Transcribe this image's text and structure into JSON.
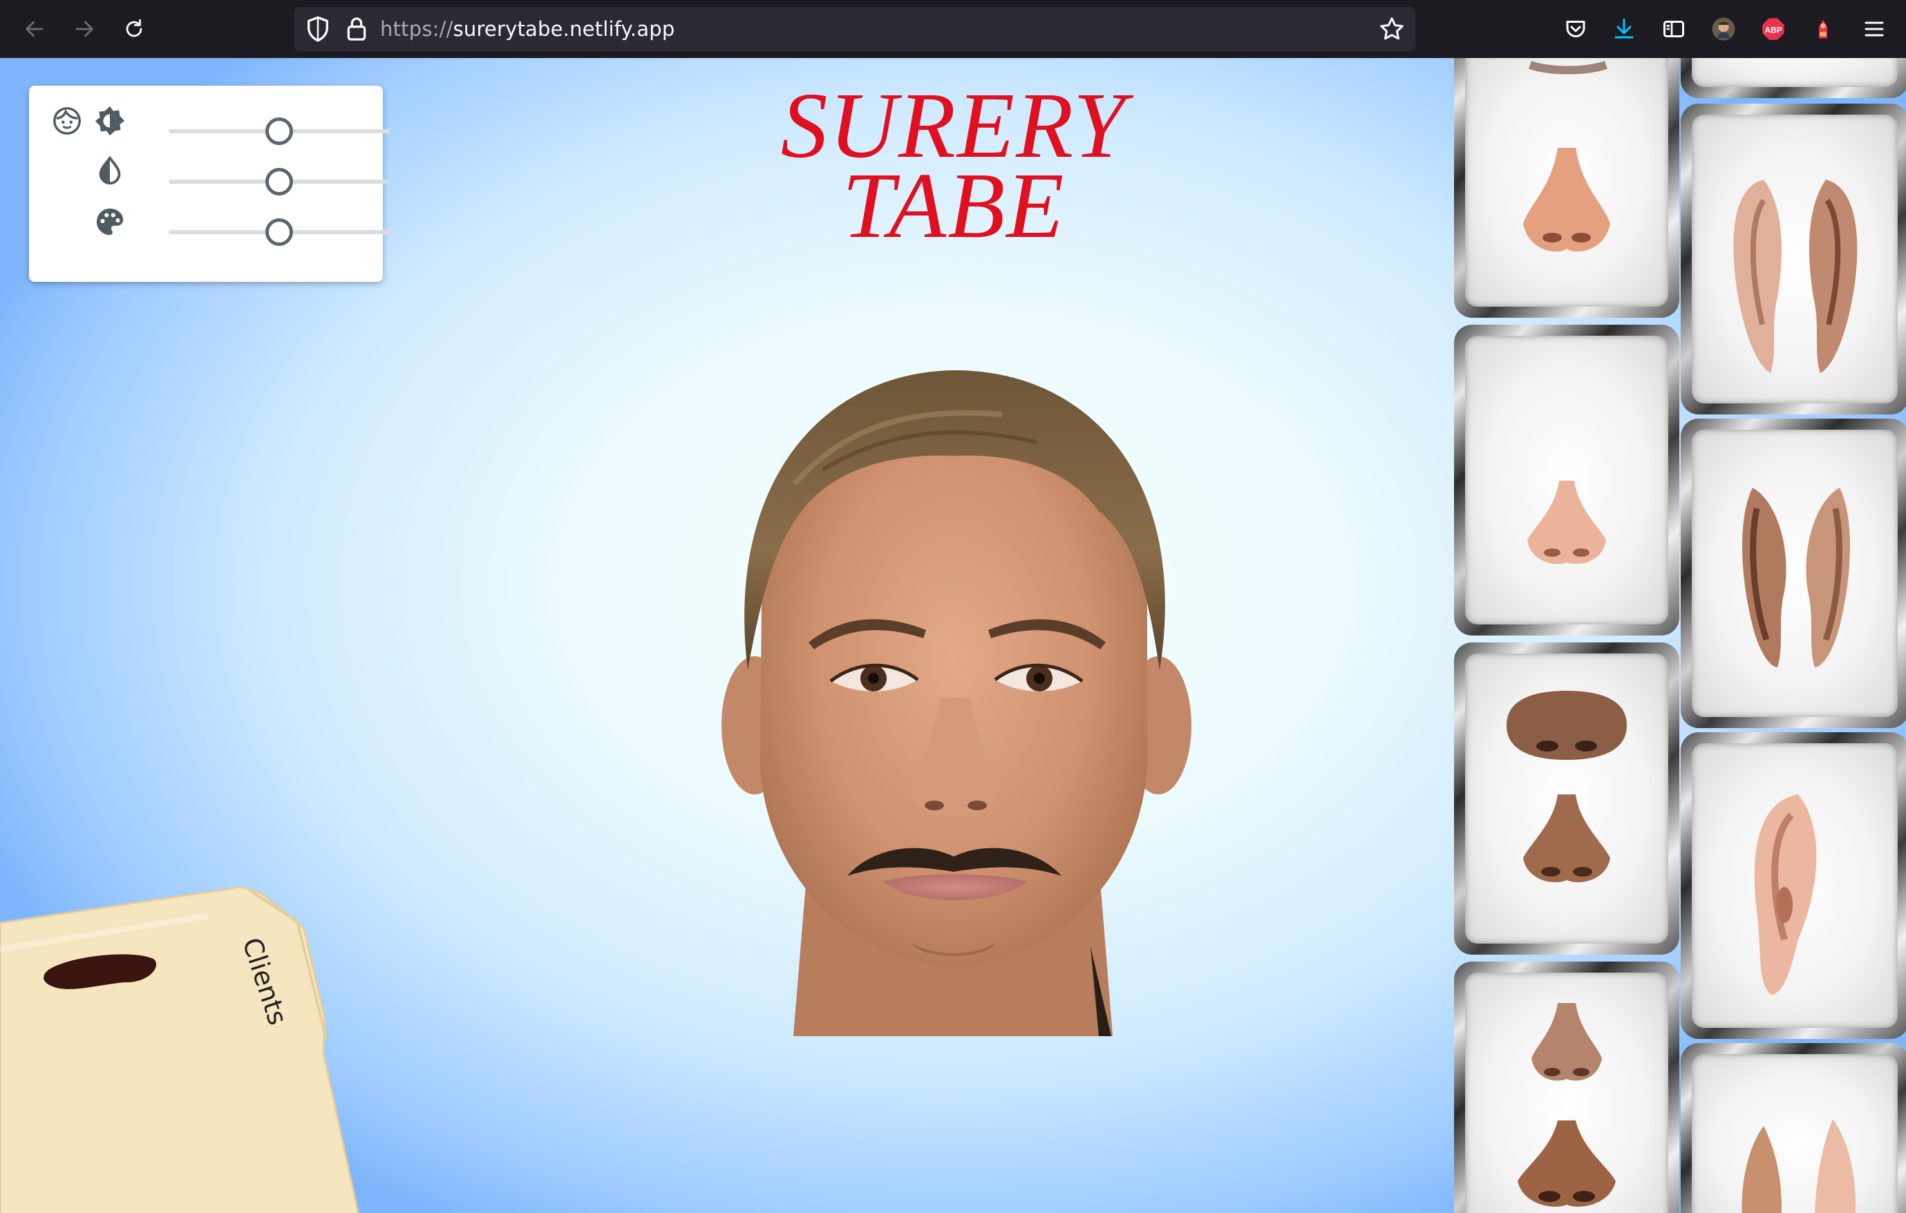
{
  "browser": {
    "url_scheme": "https://",
    "url_host": "surerytabe.netlify.app",
    "extension_abp_label": "ABP"
  },
  "page": {
    "title_line1": "SURERY",
    "title_line2": "TABE",
    "folder_label": "Clients"
  },
  "controls": {
    "brightness_level": 0.5,
    "saturation_level": 0.5,
    "hue_level": 0.5
  },
  "icons": {
    "back": "arrow-left-icon",
    "forward": "arrow-right-icon",
    "reload": "reload-icon",
    "tracking": "shield-icon",
    "secure": "lock-icon",
    "bookmark": "star-icon",
    "pocket": "pocket-icon",
    "downloads": "download-icon",
    "reader": "sidebar-icon",
    "menu": "hamburger-menu-icon",
    "face": "face-icon",
    "brightness": "brightness-icon",
    "drop": "drop-icon",
    "palette": "palette-icon"
  },
  "colors": {
    "title": "#e01020",
    "download_accent": "#00c8ff",
    "abp_red": "#e8334a"
  },
  "trays": {
    "left": [
      "nose",
      "nose",
      "nose",
      "nose"
    ],
    "right": [
      "ears",
      "ears",
      "ear",
      "ear"
    ]
  }
}
